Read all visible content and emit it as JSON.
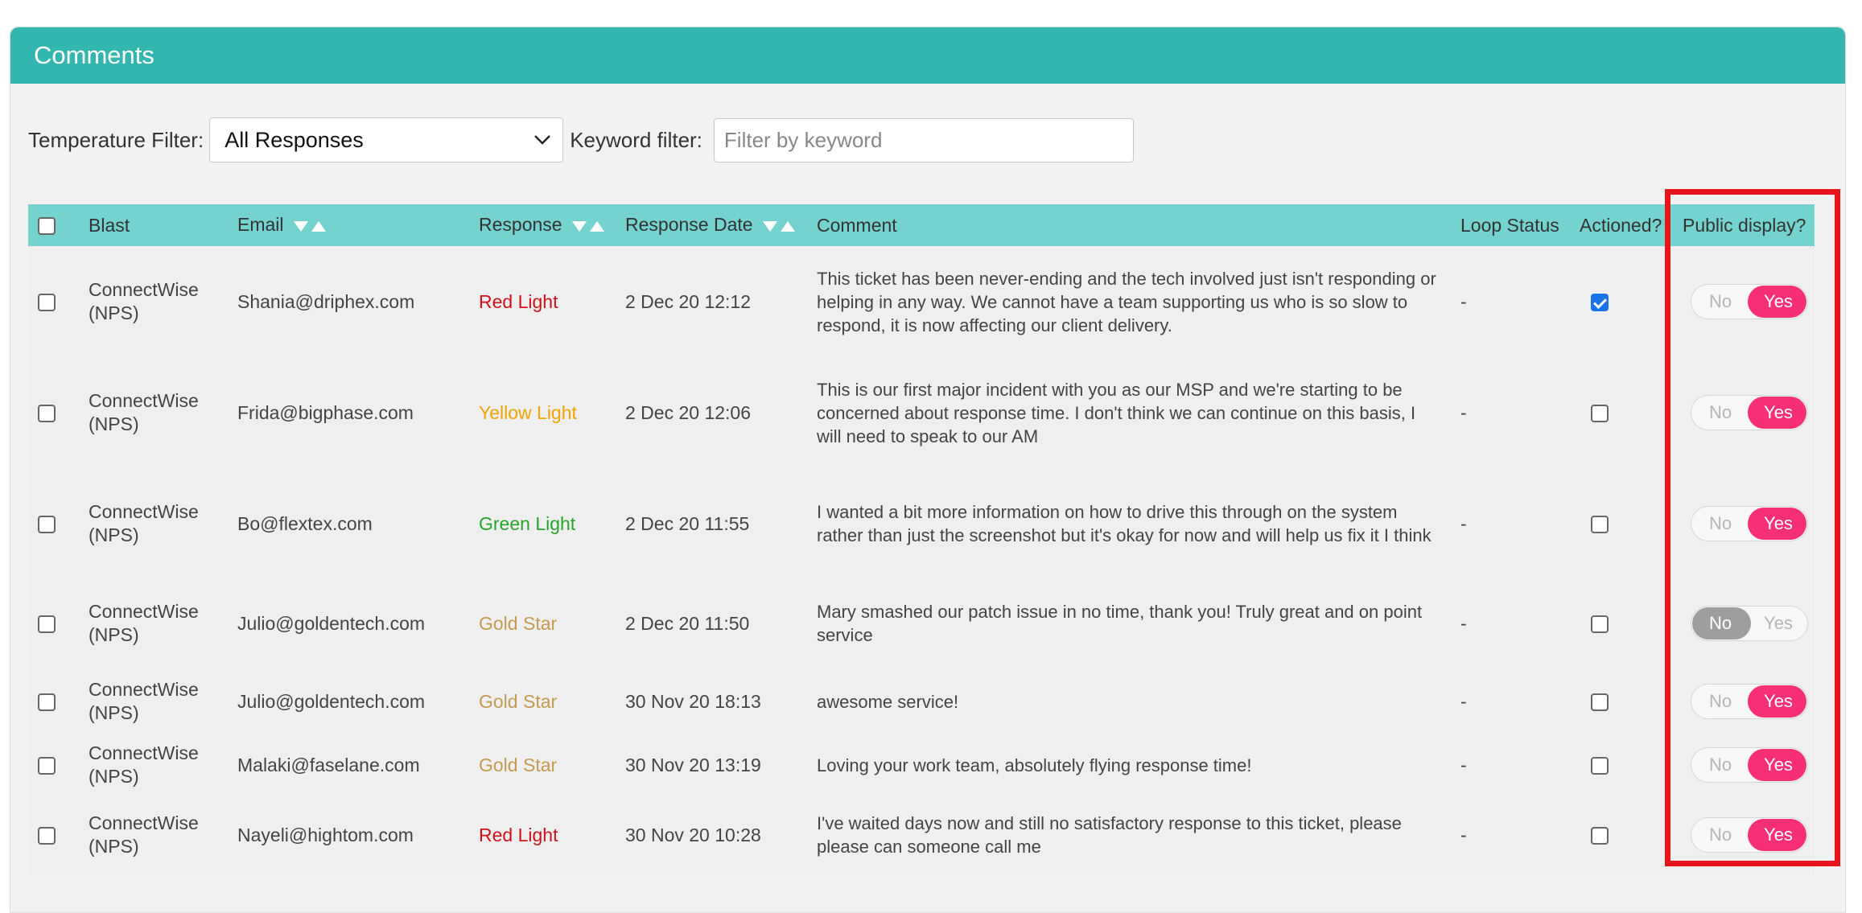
{
  "header": {
    "title": "Comments"
  },
  "filters": {
    "temperature_label": "Temperature Filter:",
    "temperature_value": "All Responses",
    "keyword_label": "Keyword filter:",
    "keyword_placeholder": "Filter by keyword",
    "keyword_value": ""
  },
  "table": {
    "columns": {
      "blast": "Blast",
      "email": "Email",
      "response": "Response",
      "response_date": "Response Date",
      "comment": "Comment",
      "loop_status": "Loop Status",
      "actioned": "Actioned?",
      "public_display": "Public display?"
    },
    "toggle_labels": {
      "no": "No",
      "yes": "Yes"
    },
    "rows": [
      {
        "blast_line1": "ConnectWise",
        "blast_line2": "(NPS)",
        "email": "Shania@driphex.com",
        "response": "Red Light",
        "response_color": "#d0121b",
        "date": "2 Dec 20 12:12",
        "comment": "This ticket has been never-ending and the tech involved just isn't responding or helping in any way. We cannot have a team supporting us who is so slow to respond, it is now affecting our client delivery.",
        "loop_status": "-",
        "actioned": true,
        "public_display": "Yes"
      },
      {
        "blast_line1": "ConnectWise",
        "blast_line2": "(NPS)",
        "email": "Frida@bigphase.com",
        "response": "Yellow Light",
        "response_color": "#f0a400",
        "date": "2 Dec 20 12:06",
        "comment": "This is our first major incident with you as our MSP and we're starting to be concerned about response time. I don't think we can continue on this basis, I will need to speak to our AM",
        "loop_status": "-",
        "actioned": false,
        "public_display": "Yes"
      },
      {
        "blast_line1": "ConnectWise",
        "blast_line2": "(NPS)",
        "email": "Bo@flextex.com",
        "response": "Green Light",
        "response_color": "#27a52a",
        "date": "2 Dec 20 11:55",
        "comment": "I wanted a bit more information on how to drive this through on the system rather than just the screenshot but it's okay for now and will help us fix it I think",
        "loop_status": "-",
        "actioned": false,
        "public_display": "Yes"
      },
      {
        "blast_line1": "ConnectWise",
        "blast_line2": "(NPS)",
        "email": "Julio@goldentech.com",
        "response": "Gold Star",
        "response_color": "#c49a52",
        "date": "2 Dec 20 11:50",
        "comment": "Mary smashed our patch issue in no time, thank you! Truly great and on point service",
        "loop_status": "-",
        "actioned": false,
        "public_display": "No"
      },
      {
        "blast_line1": "ConnectWise",
        "blast_line2": "(NPS)",
        "email": "Julio@goldentech.com",
        "response": "Gold Star",
        "response_color": "#c49a52",
        "date": "30 Nov 20 18:13",
        "comment": "awesome service!",
        "loop_status": "-",
        "actioned": false,
        "public_display": "Yes"
      },
      {
        "blast_line1": "ConnectWise",
        "blast_line2": "(NPS)",
        "email": "Malaki@faselane.com",
        "response": "Gold Star",
        "response_color": "#c49a52",
        "date": "30 Nov 20 13:19",
        "comment": "Loving your work team, absolutely flying response time!",
        "loop_status": "-",
        "actioned": false,
        "public_display": "Yes"
      },
      {
        "blast_line1": "ConnectWise",
        "blast_line2": "(NPS)",
        "email": "Nayeli@hightom.com",
        "response": "Red Light",
        "response_color": "#d0121b",
        "date": "30 Nov 20 10:28",
        "comment": "I've waited days now and still no satisfactory response to this ticket, please please can someone call me",
        "loop_status": "-",
        "actioned": false,
        "public_display": "Yes"
      }
    ]
  }
}
